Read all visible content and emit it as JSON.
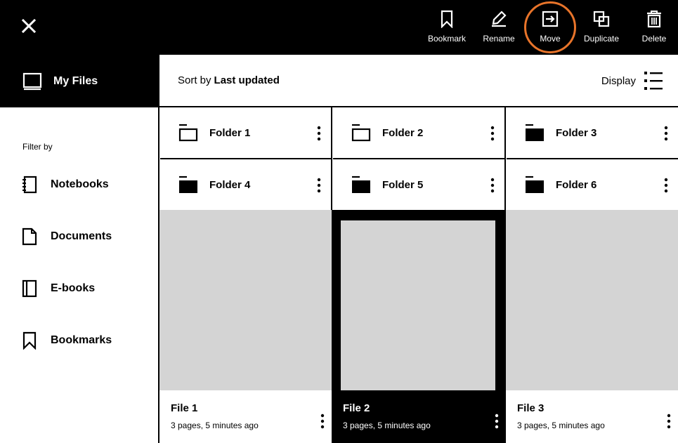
{
  "toolbar": {
    "close_label": "",
    "actions": [
      {
        "id": "bookmark",
        "label": "Bookmark",
        "icon": "bookmark-icon"
      },
      {
        "id": "rename",
        "label": "Rename",
        "icon": "pencil-icon"
      },
      {
        "id": "move",
        "label": "Move",
        "icon": "move-icon"
      },
      {
        "id": "duplicate",
        "label": "Duplicate",
        "icon": "duplicate-icon"
      },
      {
        "id": "delete",
        "label": "Delete",
        "icon": "trash-icon"
      }
    ],
    "highlight_color": "#e8742a"
  },
  "sidebar": {
    "title": "My Files",
    "filter_label": "Filter by",
    "items": [
      {
        "label": "Notebooks",
        "icon": "notebook-icon"
      },
      {
        "label": "Documents",
        "icon": "document-icon"
      },
      {
        "label": "E-books",
        "icon": "ebook-icon"
      },
      {
        "label": "Bookmarks",
        "icon": "bookmark-icon"
      }
    ]
  },
  "sortbar": {
    "sort_label": "Sort by",
    "sort_value": "Last updated",
    "display_label": "Display"
  },
  "folders": [
    {
      "name": "Folder 1",
      "style": "outline"
    },
    {
      "name": "Folder 2",
      "style": "outline"
    },
    {
      "name": "Folder 3",
      "style": "filled"
    },
    {
      "name": "Folder 4",
      "style": "filled"
    },
    {
      "name": "Folder 5",
      "style": "filled"
    },
    {
      "name": "Folder 6",
      "style": "filled"
    }
  ],
  "files": [
    {
      "name": "File 1",
      "meta": "3 pages, 5 minutes ago",
      "selected": false
    },
    {
      "name": "File 2",
      "meta": "3 pages, 5 minutes ago",
      "selected": true
    },
    {
      "name": "File 3",
      "meta": "3 pages, 5 minutes ago",
      "selected": false
    }
  ]
}
